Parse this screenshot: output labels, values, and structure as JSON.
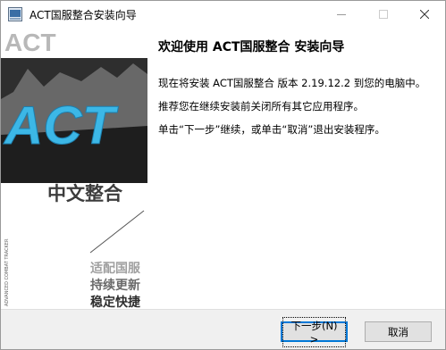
{
  "window": {
    "title": "ACT国服整合安装向导"
  },
  "banner": {
    "logo_text": "ACT",
    "header_text": "ACT",
    "subtitle": "中文整合",
    "vertical_text": "ADVANCED COMBAT TRACKER",
    "slogans": [
      "适配国服",
      "持续更新",
      "稳定快捷"
    ]
  },
  "content": {
    "heading": "欢迎使用 ACT国服整合 安装向导",
    "line1": "现在将安装 ACT国服整合 版本 2.19.12.2 到您的电脑中。",
    "line2": "推荐您在继续安装前关闭所有其它应用程序。",
    "line3": "单击“下一步”继续，或单击“取消”退出安装程序。"
  },
  "buttons": {
    "next": "下一步(N) >",
    "cancel": "取消"
  },
  "colors": {
    "accent": "#0078d7",
    "logo_blue": "#3cb7e6",
    "banner_gray": "#707070"
  }
}
